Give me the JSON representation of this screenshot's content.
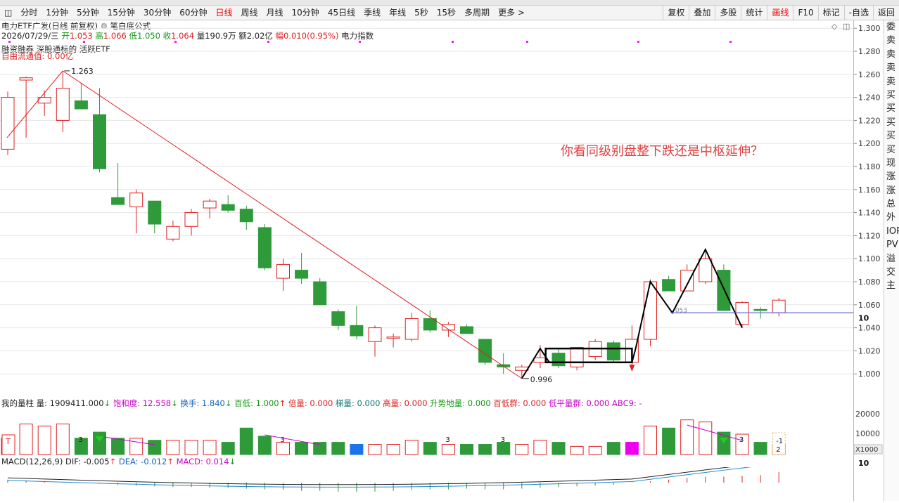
{
  "toolbar": {
    "periods": [
      "分时",
      "1分钟",
      "5分钟",
      "15分钟",
      "30分钟",
      "60分钟",
      "日线",
      "周线",
      "月线",
      "10分钟",
      "45日线",
      "季线",
      "年线",
      "5秒",
      "15秒",
      "多周期",
      "更多 >"
    ],
    "active": "日线",
    "right_buttons": [
      "复权",
      "叠加",
      "多股",
      "统计",
      "画线",
      "F10",
      "标记",
      "-自选",
      "返回"
    ],
    "right_active": "画线"
  },
  "header": {
    "title": "电力ETF广发(日线 前复权)",
    "formula_icon": "gear-icon",
    "formula": "笔白底公式",
    "date": "2026/07/29/三",
    "open_label": "开",
    "open": "1.053",
    "high_label": "高",
    "high": "1.066",
    "low_label": "低",
    "low": "1.050",
    "close_label": "收",
    "close": "1.064",
    "volume": "量190.9万",
    "amount": "额2.02亿",
    "change": "幅0.010(0.95%)",
    "index": "电力指数",
    "tags": "融资融券 深股通标的 活跃ETF",
    "float_value": "自由流通值: 0.00亿"
  },
  "annotation": "你看同级别盘整下跌还是中枢延伸？",
  "labels": {
    "high_mark": "1.263",
    "low_mark": "0.996",
    "line_mark": "053"
  },
  "price_axis": [
    "1.300",
    "1.280",
    "1.260",
    "1.240",
    "1.220",
    "1.200",
    "1.180",
    "1.160",
    "1.140",
    "1.120",
    "1.100",
    "1.080",
    "1.060",
    "1.040",
    "1.020",
    "1.000"
  ],
  "price_axis_badge": "10",
  "volume_panel": {
    "name": "我的量柱",
    "volume": "量: 1909411.000",
    "saturation": "饱和度: 12.558",
    "turnover": "换手: 1.840",
    "bailing": "百低: 1.000",
    "beiliang": "倍量: 0.000",
    "tiliang": "梯量: 0.000",
    "gaoliang": "高量: 0.000",
    "shengshi": "升势地量: 0.000",
    "bai_di_qun": "百低群: 0.000",
    "diping": "低平量群: 0.000",
    "abc": "ABC9: -",
    "axis": [
      "20000",
      "10000"
    ],
    "unit": "X1000",
    "t_marker": "T",
    "marks3": [
      "3",
      "3",
      "3",
      "3",
      "3"
    ],
    "right_marks": [
      "-1",
      "2"
    ]
  },
  "macd_panel": {
    "name": "MACD(12,26,9)",
    "dif": "DIF: -0.005",
    "dea": "DEA: -0.012",
    "macd": "MACD: 0.014",
    "axis_badge": "10"
  },
  "right_panel": [
    "委",
    "卖",
    "卖",
    "卖",
    "卖",
    "买",
    "买",
    "买",
    "买",
    "买",
    "现",
    "涨",
    "涨",
    "总",
    "外",
    "IOP",
    "PV",
    "溢",
    "交",
    "主"
  ],
  "colors": {
    "up": "#e02020",
    "down": "#2e9a3a",
    "grid": "#e6e6e6",
    "trend": "#e02020",
    "stroke": "#000000",
    "hline": "#6666dd"
  },
  "chart_data": {
    "type": "candlestick",
    "ylim": [
      0.98,
      1.305
    ],
    "candles": [
      {
        "o": 1.195,
        "h": 1.245,
        "l": 1.19,
        "c": 1.24
      },
      {
        "o": 1.255,
        "h": 1.258,
        "l": 1.205,
        "c": 1.257
      },
      {
        "o": 1.235,
        "h": 1.246,
        "l": 1.224,
        "c": 1.24
      },
      {
        "o": 1.22,
        "h": 1.262,
        "l": 1.21,
        "c": 1.248
      },
      {
        "o": 1.237,
        "h": 1.252,
        "l": 1.231,
        "c": 1.23
      },
      {
        "o": 1.225,
        "h": 1.248,
        "l": 1.175,
        "c": 1.178
      },
      {
        "o": 1.153,
        "h": 1.183,
        "l": 1.148,
        "c": 1.147
      },
      {
        "o": 1.145,
        "h": 1.16,
        "l": 1.122,
        "c": 1.157
      },
      {
        "o": 1.15,
        "h": 1.15,
        "l": 1.122,
        "c": 1.13
      },
      {
        "o": 1.117,
        "h": 1.133,
        "l": 1.115,
        "c": 1.128
      },
      {
        "o": 1.128,
        "h": 1.143,
        "l": 1.12,
        "c": 1.14
      },
      {
        "o": 1.144,
        "h": 1.152,
        "l": 1.135,
        "c": 1.15
      },
      {
        "o": 1.147,
        "h": 1.155,
        "l": 1.14,
        "c": 1.142
      },
      {
        "o": 1.143,
        "h": 1.146,
        "l": 1.125,
        "c": 1.132
      },
      {
        "o": 1.127,
        "h": 1.13,
        "l": 1.09,
        "c": 1.092
      },
      {
        "o": 1.083,
        "h": 1.1,
        "l": 1.072,
        "c": 1.095
      },
      {
        "o": 1.09,
        "h": 1.105,
        "l": 1.078,
        "c": 1.083
      },
      {
        "o": 1.08,
        "h": 1.083,
        "l": 1.06,
        "c": 1.06
      },
      {
        "o": 1.054,
        "h": 1.056,
        "l": 1.038,
        "c": 1.042
      },
      {
        "o": 1.042,
        "h": 1.059,
        "l": 1.03,
        "c": 1.033
      },
      {
        "o": 1.028,
        "h": 1.042,
        "l": 1.015,
        "c": 1.04
      },
      {
        "o": 1.031,
        "h": 1.035,
        "l": 1.023,
        "c": 1.032
      },
      {
        "o": 1.03,
        "h": 1.053,
        "l": 1.028,
        "c": 1.048
      },
      {
        "o": 1.048,
        "h": 1.055,
        "l": 1.036,
        "c": 1.038
      },
      {
        "o": 1.038,
        "h": 1.045,
        "l": 1.032,
        "c": 1.043
      },
      {
        "o": 1.041,
        "h": 1.043,
        "l": 1.035,
        "c": 1.035
      },
      {
        "o": 1.03,
        "h": 1.03,
        "l": 1.008,
        "c": 1.01
      },
      {
        "o": 1.008,
        "h": 1.018,
        "l": 1.0,
        "c": 1.006
      },
      {
        "o": 1.003,
        "h": 1.008,
        "l": 0.996,
        "c": 1.006
      },
      {
        "o": 1.01,
        "h": 1.025,
        "l": 1.005,
        "c": 1.014
      },
      {
        "o": 1.018,
        "h": 1.022,
        "l": 1.005,
        "c": 1.007
      },
      {
        "o": 1.006,
        "h": 1.023,
        "l": 1.003,
        "c": 1.023
      },
      {
        "o": 1.015,
        "h": 1.03,
        "l": 1.012,
        "c": 1.028
      },
      {
        "o": 1.027,
        "h": 1.029,
        "l": 1.01,
        "c": 1.012
      },
      {
        "o": 1.01,
        "h": 1.042,
        "l": 1.008,
        "c": 1.03
      },
      {
        "o": 1.03,
        "h": 1.082,
        "l": 1.024,
        "c": 1.08
      },
      {
        "o": 1.082,
        "h": 1.085,
        "l": 1.072,
        "c": 1.072
      },
      {
        "o": 1.072,
        "h": 1.095,
        "l": 1.072,
        "c": 1.09
      },
      {
        "o": 1.08,
        "h": 1.108,
        "l": 1.078,
        "c": 1.1
      },
      {
        "o": 1.09,
        "h": 1.095,
        "l": 1.055,
        "c": 1.055
      },
      {
        "o": 1.043,
        "h": 1.063,
        "l": 1.04,
        "c": 1.062
      },
      {
        "o": 1.056,
        "h": 1.058,
        "l": 1.048,
        "c": 1.055
      },
      {
        "o": 1.053,
        "h": 1.066,
        "l": 1.05,
        "c": 1.064
      }
    ],
    "volumes": [
      8,
      15,
      14,
      15,
      8,
      11,
      8,
      8,
      7,
      7,
      7,
      7,
      6,
      13,
      9,
      6,
      6,
      6,
      6,
      5,
      5,
      5,
      7,
      6,
      5,
      5,
      5,
      6,
      5,
      7,
      6,
      4,
      4,
      6,
      6,
      14,
      13,
      17,
      16,
      11,
      10,
      6,
      5
    ],
    "macd_hist": [
      0.004,
      0.003,
      0.002,
      0.001,
      0,
      -0.001,
      -0.003,
      -0.004,
      -0.005,
      -0.006,
      -0.006,
      -0.007,
      -0.007,
      -0.008,
      -0.009,
      -0.01,
      -0.011,
      -0.011,
      -0.012,
      -0.012,
      -0.012,
      -0.011,
      -0.01,
      -0.009,
      -0.009,
      -0.008,
      -0.009,
      -0.009,
      -0.008,
      -0.007,
      -0.006,
      -0.005,
      -0.004,
      -0.003,
      -0.001,
      0.002,
      0.004,
      0.006,
      0.008,
      0.008,
      0.009,
      0.01,
      0.014
    ]
  }
}
